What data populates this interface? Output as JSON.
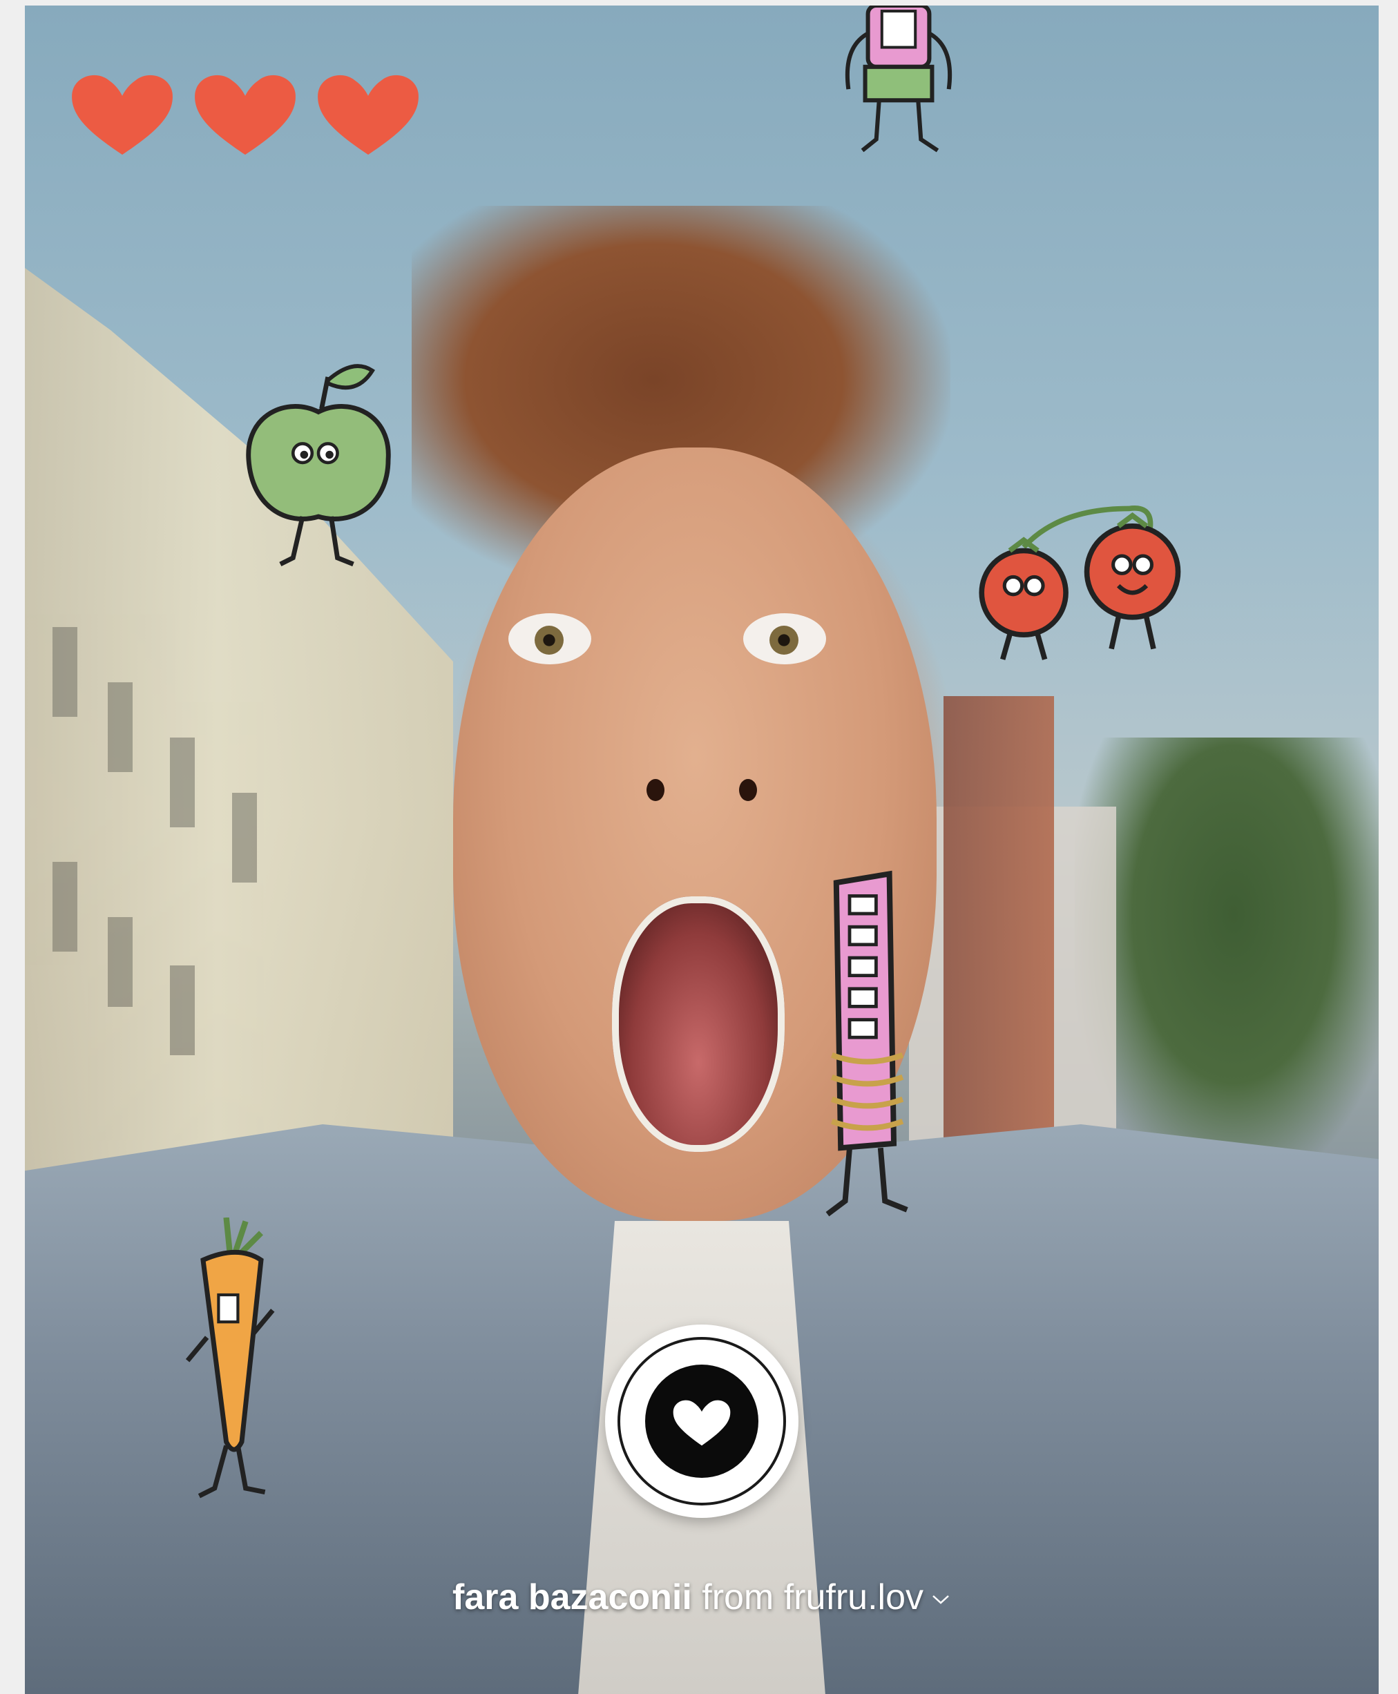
{
  "hearts": {
    "count": 3,
    "color": "#ec5b43"
  },
  "stickers": [
    {
      "name": "pink-monster-top",
      "kind": "monster"
    },
    {
      "name": "green-apple",
      "kind": "apple"
    },
    {
      "name": "tomato-pair",
      "kind": "tomato"
    },
    {
      "name": "pink-tower-monster",
      "kind": "tower"
    },
    {
      "name": "carrot",
      "kind": "carrot"
    }
  ],
  "shutter": {
    "icon": "heart-icon"
  },
  "effect": {
    "name": "fara bazaconii",
    "from_label": "from",
    "author": "frufru.lov",
    "chevron": "chevron-down-icon"
  }
}
